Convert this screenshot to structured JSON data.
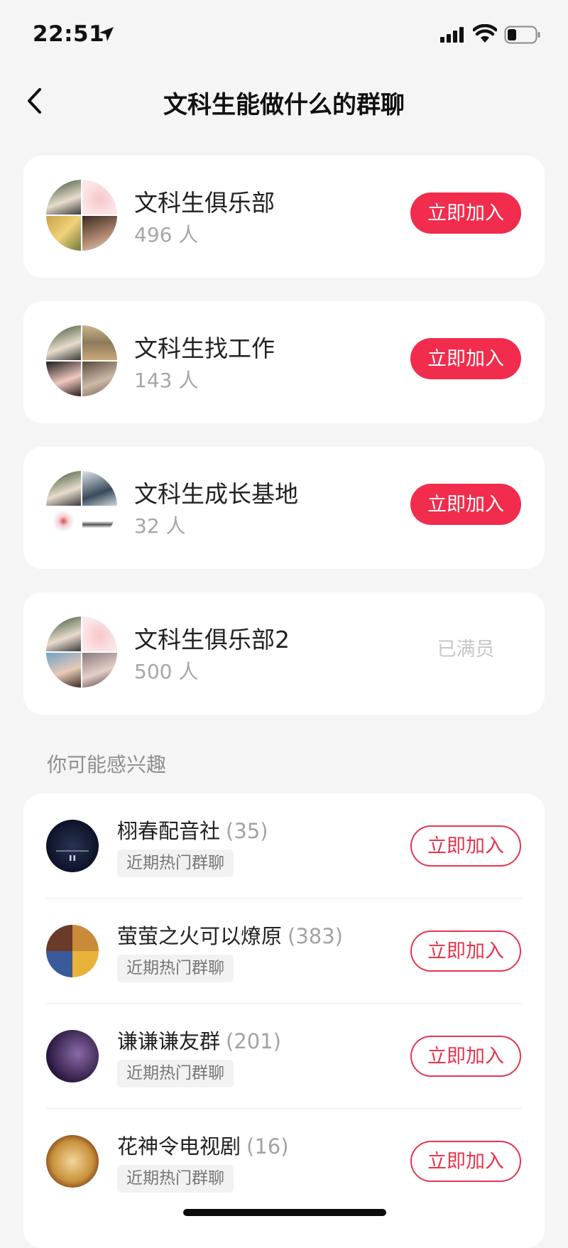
{
  "status": {
    "time": "22:51"
  },
  "header": {
    "title": "文科生能做什么的群聊"
  },
  "groups": [
    {
      "name": "文科生俱乐部",
      "count": "496 人",
      "action": "立即加入"
    },
    {
      "name": "文科生找工作",
      "count": "143 人",
      "action": "立即加入"
    },
    {
      "name": "文科生成长基地",
      "count": "32 人",
      "action": "立即加入"
    },
    {
      "name": "文科生俱乐部2",
      "count": "500 人",
      "action": "已满员"
    }
  ],
  "recommend": {
    "header": "你可能感兴趣",
    "items": [
      {
        "name": "栩春配音社",
        "count": "(35)",
        "tag": "近期热门群聊",
        "action": "立即加入"
      },
      {
        "name": "萤萤之火可以燎原",
        "count": "(383)",
        "tag": "近期热门群聊",
        "action": "立即加入"
      },
      {
        "name": "谦谦谦友群",
        "count": "(201)",
        "tag": "近期热门群聊",
        "action": "立即加入"
      },
      {
        "name": "花神令电视剧",
        "count": "(16)",
        "tag": "近期热门群聊",
        "action": "立即加入"
      }
    ]
  },
  "colors": {
    "accent": "#f12c4c",
    "background": "#f5f5f5",
    "card": "#ffffff"
  }
}
